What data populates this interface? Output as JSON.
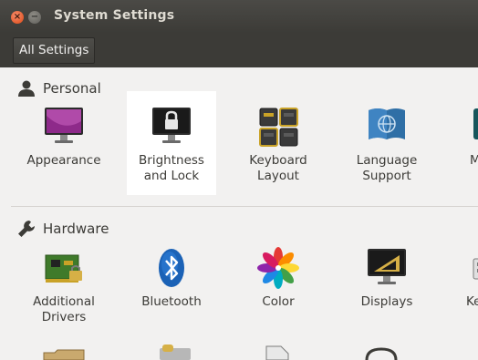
{
  "window": {
    "title": "System Settings"
  },
  "toolbar": {
    "all_settings_label": "All Settings"
  },
  "sections": {
    "personal": {
      "title": "Personal",
      "items": [
        {
          "label": "Appearance",
          "icon": "appearance-icon"
        },
        {
          "label": "Brightness\nand Lock",
          "icon": "brightness-lock-icon",
          "selected": true
        },
        {
          "label": "Keyboard\nLayout",
          "icon": "keyboard-layout-icon"
        },
        {
          "label": "Language\nSupport",
          "icon": "language-support-icon"
        },
        {
          "label": "M",
          "icon": "partial-item-icon"
        }
      ]
    },
    "hardware": {
      "title": "Hardware",
      "items": [
        {
          "label": "Additional\nDrivers",
          "icon": "additional-drivers-icon"
        },
        {
          "label": "Bluetooth",
          "icon": "bluetooth-icon"
        },
        {
          "label": "Color",
          "icon": "color-icon"
        },
        {
          "label": "Displays",
          "icon": "displays-icon"
        },
        {
          "label": "Ke",
          "icon": "partial-item-icon"
        }
      ]
    }
  },
  "colors": {
    "titlebar": "#3c3b37",
    "close_button": "#dd4814",
    "selected_bg": "#ffffff",
    "window_bg": "#f2f1f0"
  }
}
